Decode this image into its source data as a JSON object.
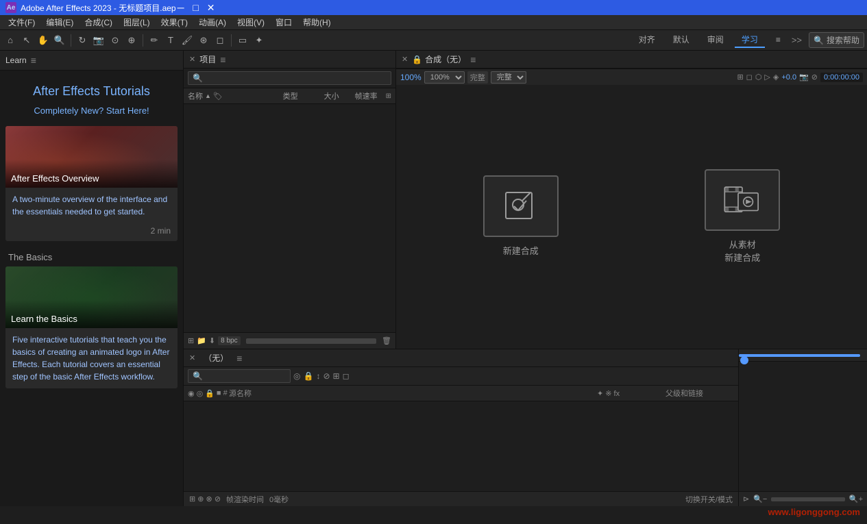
{
  "titlebar": {
    "app_name": "Adobe After Effects 2023",
    "separator": "-",
    "filename": "无标题项目.aep",
    "app_icon_text": "Ae",
    "minimize": "─",
    "maximize": "□",
    "close": "✕"
  },
  "menubar": {
    "items": [
      {
        "label": "文件(F)"
      },
      {
        "label": "编辑(E)"
      },
      {
        "label": "合成(C)"
      },
      {
        "label": "图层(L)"
      },
      {
        "label": "效果(T)"
      },
      {
        "label": "动画(A)"
      },
      {
        "label": "视图(V)"
      },
      {
        "label": "窗口"
      },
      {
        "label": "帮助(H)"
      }
    ]
  },
  "workspace_bar": {
    "tabs": [
      {
        "label": "对齐",
        "active": false
      },
      {
        "label": "默认",
        "active": false
      },
      {
        "label": "审阅",
        "active": false
      },
      {
        "label": "学习",
        "active": true
      },
      {
        "label": "≡",
        "active": false
      }
    ],
    "more_btn": ">>",
    "search_placeholder": "搜索帮助",
    "search_icon": "🔍"
  },
  "learn_panel": {
    "header": "Learn",
    "menu_icon": "≡",
    "title": "After Effects Tutorials",
    "subtitle": "Completely New? Start Here!",
    "sections": [
      {
        "label": "",
        "cards": [
          {
            "id": "overview",
            "title": "After Effects Overview",
            "description": "A two-minute overview of the interface and the essentials needed to get started.",
            "duration": "2 min",
            "thumb_type": "overview"
          }
        ]
      },
      {
        "label": "The Basics",
        "cards": [
          {
            "id": "basics",
            "title": "Learn the Basics",
            "description": "Five interactive tutorials that teach you the basics of creating an animated logo in After Effects. Each tutorial covers an essential step of the basic After Effects workflow.",
            "duration": "",
            "thumb_type": "basics"
          }
        ]
      }
    ]
  },
  "project_panel": {
    "header": "项目",
    "menu_icon": "≡",
    "close_icon": "✕",
    "search_placeholder": "🔍",
    "columns": {
      "name": "名称",
      "sort_icon": "▲",
      "tag_icon": "🏷",
      "type": "类型",
      "size": "大小",
      "fps": "帧速率"
    },
    "bpc": "8 bpc",
    "footer_icons": [
      "⊞",
      "📁",
      "📋",
      "🎞"
    ],
    "footer_bar_label": ""
  },
  "comp_panel": {
    "header": "合成（无）",
    "menu_icon": "≡",
    "close_icon": "✕",
    "new_comp_label": "新建合成",
    "from_footage_label": "从素材\n新建合成",
    "zoom_level": "100%",
    "quality": "完整",
    "timecode": "0:00:00:00",
    "plus_val": "+0.0"
  },
  "timeline_panel": {
    "header": "（无）",
    "menu_icon": "≡",
    "close_icon": "✕",
    "columns": {
      "source": "源名称",
      "switches": "✦ ※ fx",
      "parent": "父级和链接"
    },
    "footer_left": "帧渲染时间",
    "footer_left_val": "0毫秒",
    "footer_right": "切换开关/模式"
  },
  "watermark": {
    "text": "www.ligonggong.com"
  }
}
